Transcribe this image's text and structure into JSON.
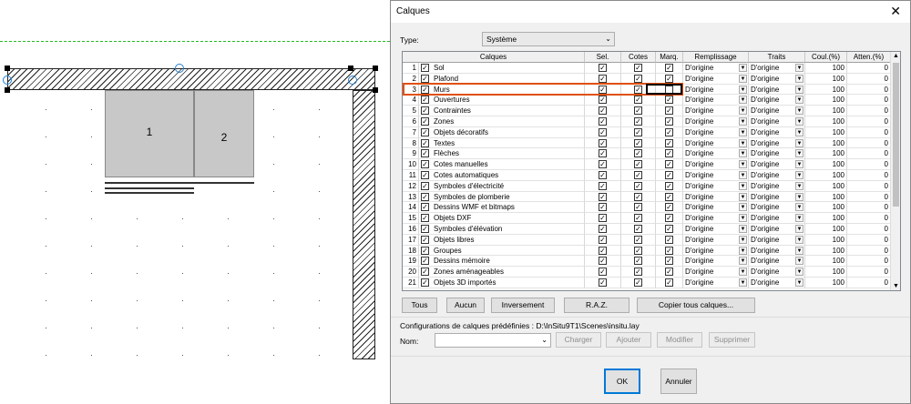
{
  "plan": {
    "cabinet1_label": "1",
    "cabinet2_label": "2"
  },
  "dialog": {
    "title": "Calques",
    "close_glyph": "✕",
    "type_label": "Type:",
    "type_value": "Système",
    "columns": [
      "Calques",
      "Sel.",
      "Cotes",
      "Marq.",
      "Remplissage",
      "Traits",
      "Coul.(%)",
      "Atten.(%)"
    ],
    "rows": [
      {
        "idx": "1",
        "name": "Sol",
        "fill": "D'origine",
        "line": "D'origine",
        "coul": "100",
        "atten": "0",
        "marq": true
      },
      {
        "idx": "2",
        "name": "Plafond",
        "fill": "D'origine",
        "line": "D'origine",
        "coul": "100",
        "atten": "0",
        "marq": true
      },
      {
        "idx": "3",
        "name": "Murs",
        "fill": "D'origine",
        "line": "D'origine",
        "coul": "100",
        "atten": "0",
        "marq": false
      },
      {
        "idx": "4",
        "name": "Ouvertures",
        "fill": "D'origine",
        "line": "D'origine",
        "coul": "100",
        "atten": "0",
        "marq": true
      },
      {
        "idx": "5",
        "name": "Contraintes",
        "fill": "D'origine",
        "line": "D'origine",
        "coul": "100",
        "atten": "0",
        "marq": true
      },
      {
        "idx": "6",
        "name": "Zones",
        "fill": "D'origine",
        "line": "D'origine",
        "coul": "100",
        "atten": "0",
        "marq": true
      },
      {
        "idx": "7",
        "name": "Objets décoratifs",
        "fill": "D'origine",
        "line": "D'origine",
        "coul": "100",
        "atten": "0",
        "marq": true
      },
      {
        "idx": "8",
        "name": "Textes",
        "fill": "D'origine",
        "line": "D'origine",
        "coul": "100",
        "atten": "0",
        "marq": true
      },
      {
        "idx": "9",
        "name": "Flèches",
        "fill": "D'origine",
        "line": "D'origine",
        "coul": "100",
        "atten": "0",
        "marq": true
      },
      {
        "idx": "10",
        "name": "Cotes manuelles",
        "fill": "D'origine",
        "line": "D'origine",
        "coul": "100",
        "atten": "0",
        "marq": true
      },
      {
        "idx": "11",
        "name": "Cotes automatiques",
        "fill": "D'origine",
        "line": "D'origine",
        "coul": "100",
        "atten": "0",
        "marq": true
      },
      {
        "idx": "12",
        "name": "Symboles d'électricité",
        "fill": "D'origine",
        "line": "D'origine",
        "coul": "100",
        "atten": "0",
        "marq": true
      },
      {
        "idx": "13",
        "name": "Symboles de plomberie",
        "fill": "D'origine",
        "line": "D'origine",
        "coul": "100",
        "atten": "0",
        "marq": true
      },
      {
        "idx": "14",
        "name": "Dessins WMF et bitmaps",
        "fill": "D'origine",
        "line": "D'origine",
        "coul": "100",
        "atten": "0",
        "marq": true
      },
      {
        "idx": "15",
        "name": "Objets DXF",
        "fill": "D'origine",
        "line": "D'origine",
        "coul": "100",
        "atten": "0",
        "marq": true
      },
      {
        "idx": "16",
        "name": "Symboles d'élévation",
        "fill": "D'origine",
        "line": "D'origine",
        "coul": "100",
        "atten": "0",
        "marq": true
      },
      {
        "idx": "17",
        "name": "Objets libres",
        "fill": "D'origine",
        "line": "D'origine",
        "coul": "100",
        "atten": "0",
        "marq": true
      },
      {
        "idx": "18",
        "name": "Groupes",
        "fill": "D'origine",
        "line": "D'origine",
        "coul": "100",
        "atten": "0",
        "marq": true
      },
      {
        "idx": "19",
        "name": "Dessins mémoire",
        "fill": "D'origine",
        "line": "D'origine",
        "coul": "100",
        "atten": "0",
        "marq": true
      },
      {
        "idx": "20",
        "name": "Zones aménageables",
        "fill": "D'origine",
        "line": "D'origine",
        "coul": "100",
        "atten": "0",
        "marq": true
      },
      {
        "idx": "21",
        "name": "Objets 3D importés",
        "fill": "D'origine",
        "line": "D'origine",
        "coul": "100",
        "atten": "0",
        "marq": true
      }
    ],
    "buttons": {
      "tous": "Tous",
      "aucun": "Aucun",
      "inversement": "Inversement",
      "raz": "R.A.Z.",
      "copier": "Copier tous calques..."
    },
    "config_label": "Configurations de calques prédéfinies : D:\\InSitu9T1\\Scenes\\insitu.lay",
    "nom_label": "Nom:",
    "nom_value": "",
    "config_buttons": {
      "charger": "Charger",
      "ajouter": "Ajouter",
      "modifier": "Modifier",
      "supprimer": "Supprimer"
    },
    "ok": "OK",
    "annuler": "Annuler"
  },
  "colors": {
    "highlight": "#e05010",
    "accent": "#0078d7",
    "guide": "#22bb22"
  }
}
